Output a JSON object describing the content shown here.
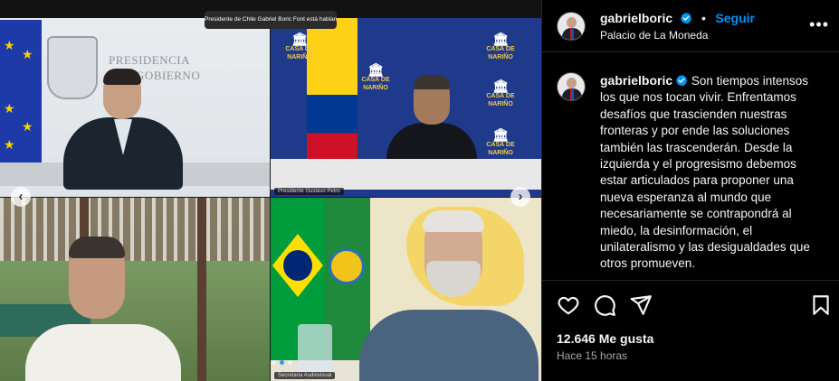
{
  "media": {
    "speaking_banner": "Presidente de Chile Gabriel Boric Font está hablando...",
    "tiles": [
      {
        "logo_text_line1": "PRESIDENCIA",
        "logo_text_line2": "DEL GOBIERNO",
        "nameplate": ""
      },
      {
        "casa_label": "CASA DE NARIÑO",
        "nameplate": "Presidente Gustavo Petro"
      },
      {
        "nameplate": ""
      },
      {
        "nameplate": "Secretaria Audiovisual"
      }
    ],
    "prev_arrow": "‹",
    "next_arrow": "›"
  },
  "post": {
    "username": "gabrielboric",
    "separator": "•",
    "follow_label": "Seguir",
    "location": "Palacio de La Moneda",
    "more_label": "•••",
    "caption": "Son tiempos intensos los que nos tocan vivir. Enfrentamos desafíos que trascienden nuestras fronteras y por ende las soluciones también las trascenderán. Desde la izquierda y el progresismo debemos estar articulados para proponer una nueva esperanza al mundo que necesariamente se contrapondrá al miedo, la desinformación, el unilateralismo y las desigualdades que otros promueven.",
    "likes": "12.646 Me gusta",
    "time": "Hace 15 horas",
    "icons": {
      "like": "heart-icon",
      "comment": "comment-icon",
      "share": "paper-plane-icon",
      "save": "bookmark-icon"
    }
  },
  "colors": {
    "verified": "#0095f6",
    "follow": "#0095f6",
    "background": "#000000",
    "divider": "#262626"
  }
}
